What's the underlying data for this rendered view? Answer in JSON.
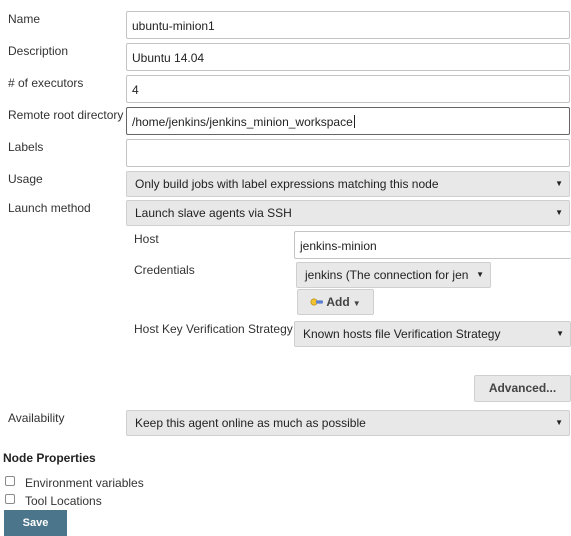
{
  "form": {
    "name": {
      "label": "Name",
      "value": "ubuntu-minion1"
    },
    "description": {
      "label": "Description",
      "value": "Ubuntu 14.04"
    },
    "executors": {
      "label": "# of executors",
      "value": "4"
    },
    "remote_root": {
      "label": "Remote root directory",
      "value": "/home/jenkins/jenkins_minion_workspace"
    },
    "labels": {
      "label": "Labels",
      "value": ""
    },
    "usage": {
      "label": "Usage",
      "value": "Only build jobs with label expressions matching this node"
    },
    "launch_method": {
      "label": "Launch method",
      "value": "Launch slave agents via SSH"
    },
    "host": {
      "label": "Host",
      "value": "jenkins-minion"
    },
    "credentials": {
      "label": "Credentials",
      "value": "jenkins (The connection for jen",
      "add_label": "Add"
    },
    "host_key": {
      "label": "Host Key Verification Strategy",
      "value": "Known hosts file Verification Strategy"
    },
    "advanced_label": "Advanced...",
    "availability": {
      "label": "Availability",
      "value": "Keep this agent online as much as possible"
    }
  },
  "node_properties": {
    "title": "Node Properties",
    "items": [
      {
        "label": "Environment variables",
        "checked": false
      },
      {
        "label": "Tool Locations",
        "checked": false
      }
    ]
  },
  "save_label": "Save",
  "icons": {
    "dropdown": "caret-down-icon",
    "add": "key-add-icon"
  },
  "colors": {
    "save_bg": "#4b758b",
    "select_bg": "#e8e8e8"
  }
}
